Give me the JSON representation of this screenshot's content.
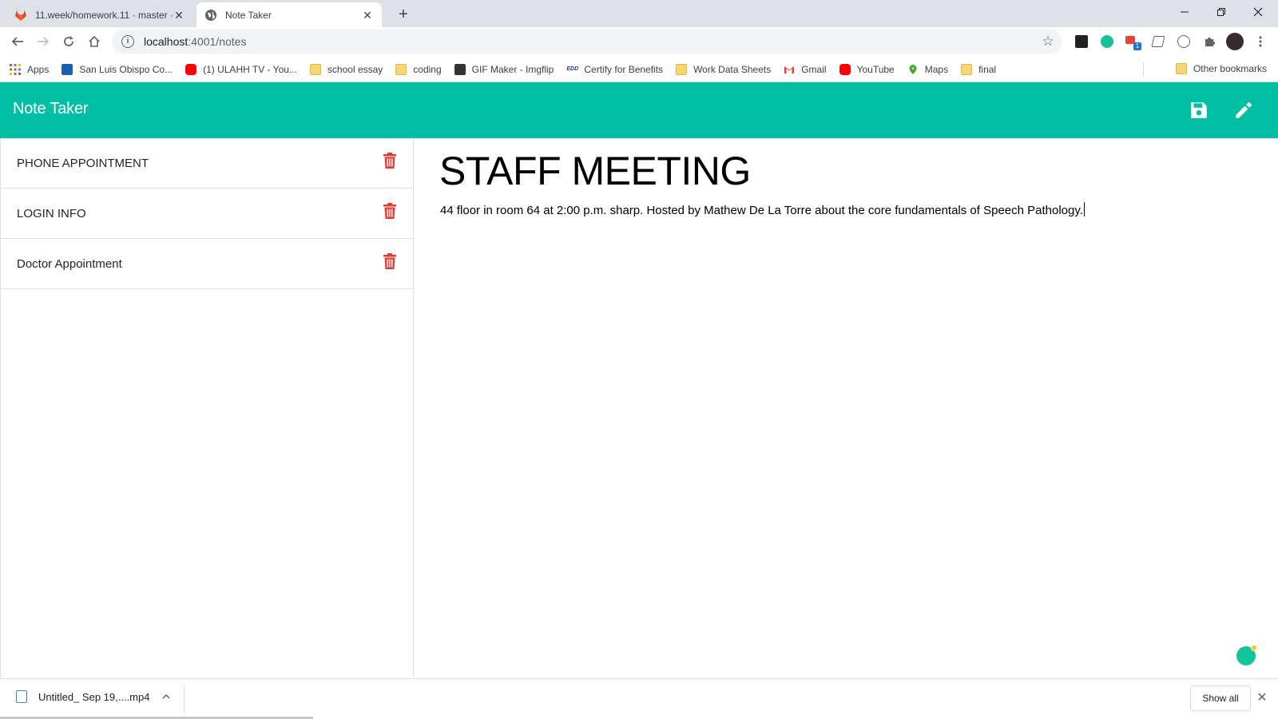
{
  "browser": {
    "tabs": [
      {
        "title": "11.week/homework.11 · master ·",
        "favicon": "gitlab-icon",
        "active": false
      },
      {
        "title": "Note Taker",
        "favicon": "globe-icon",
        "active": true
      }
    ],
    "address": {
      "host": "localhost",
      "path": ":4001/notes"
    },
    "bookmarks": [
      {
        "label": "Apps",
        "icon": "apps-grid-icon"
      },
      {
        "label": "San Luis Obispo Co...",
        "icon": "site-icon"
      },
      {
        "label": "(1) ULAHH TV - You...",
        "icon": "youtube-icon"
      },
      {
        "label": "school essay",
        "icon": "folder-icon"
      },
      {
        "label": "coding",
        "icon": "folder-icon"
      },
      {
        "label": "GIF Maker - Imgflip",
        "icon": "imgflip-icon"
      },
      {
        "label": "Certify for Benefits",
        "icon": "edd-icon"
      },
      {
        "label": "Work Data Sheets",
        "icon": "folder-icon"
      },
      {
        "label": "Gmail",
        "icon": "gmail-icon"
      },
      {
        "label": "YouTube",
        "icon": "youtube-icon"
      },
      {
        "label": "Maps",
        "icon": "maps-icon"
      },
      {
        "label": "final",
        "icon": "folder-icon"
      }
    ],
    "other_bookmarks": "Other bookmarks",
    "colors": {
      "tabstrip": "#dee1e6",
      "accent": "#00bfa5",
      "trash": "#e53935"
    }
  },
  "app": {
    "brand": "Note Taker",
    "notes": [
      {
        "title": "PHONE APPOINTMENT"
      },
      {
        "title": "LOGIN INFO"
      },
      {
        "title": "Doctor Appointment"
      }
    ],
    "active_note": {
      "title": "STAFF MEETING",
      "text": "44 floor in room 64 at 2:00 p.m. sharp. Hosted by Mathew De La Torre about the core fundamentals of Speech Pathology."
    }
  },
  "downloads": {
    "file": "Untitled_ Sep 19,....mp4",
    "show_all": "Show all"
  }
}
